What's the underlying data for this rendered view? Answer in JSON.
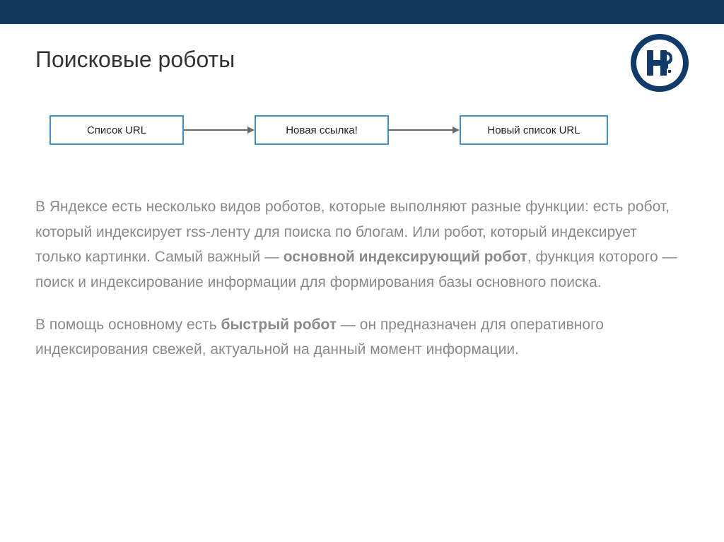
{
  "title": "Поисковые роботы",
  "diagram": {
    "node1": "Список URL",
    "node2": "Новая ссылка!",
    "node3": "Новый список URL"
  },
  "para1": {
    "t1": "В Яндексе есть несколько видов роботов, которые выполняют разные функции: есть робот, который индексирует rss-ленту для поиска по блогам. Или робот, который индексирует только картинки. Самый важный — ",
    "b1": "основной индексирующий робот",
    "t2": ", функция которого — поиск и индексирование информации для формирования базы основного поиска."
  },
  "para2": {
    "t1": "В помощь основному есть ",
    "b1": "быстрый робот",
    "t2": " — он предназначен для оперативного индексирования свежей, актуальной на данный момент информации."
  }
}
